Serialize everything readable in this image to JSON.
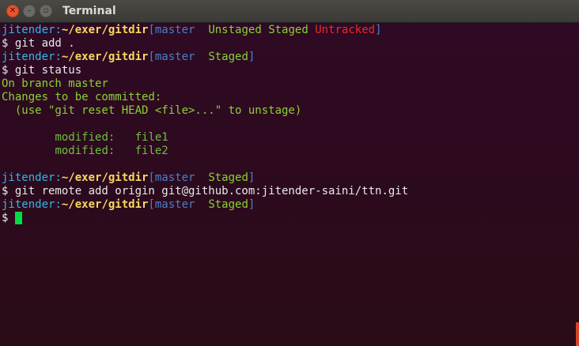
{
  "window": {
    "title": "Terminal"
  },
  "prompt": {
    "user": "jitender",
    "sep": ":",
    "path": "~/exer/gitdir",
    "dollar": "$ "
  },
  "lines": [
    {
      "open": "[master  ",
      "unstaged": "Unstaged",
      "staged": "Staged",
      "untracked": "Untracked",
      "close": "]"
    },
    {
      "cmd": "git add ."
    },
    {
      "open": "[master  ",
      "staged": "Staged",
      "close": "]"
    },
    {
      "cmd": "git status"
    },
    {
      "text": "On branch master"
    },
    {
      "text": "Changes to be committed:"
    },
    {
      "text": "  (use \"git reset HEAD <file>...\" to unstage)"
    },
    {
      "mod_label": "modified:",
      "mod_file": "file1"
    },
    {
      "mod_label": "modified:",
      "mod_file": "file2"
    },
    {
      "open": "[master  ",
      "staged": "Staged",
      "close": "]"
    },
    {
      "cmd": "git remote add origin git@github.com:jitender-saini/ttn.git"
    },
    {
      "open": "[master  ",
      "staged": "Staged",
      "close": "]"
    }
  ],
  "colors": {
    "background": "#2c0a1f",
    "user": "#34b6e8",
    "path": "#f8d760",
    "git_branch": "#4c7fc7",
    "staged": "#8ad234",
    "untracked": "#ef2929",
    "cursor": "#00dd44"
  },
  "icons": {
    "close": "close-icon",
    "minimize": "minimize-icon",
    "maximize": "maximize-icon"
  }
}
